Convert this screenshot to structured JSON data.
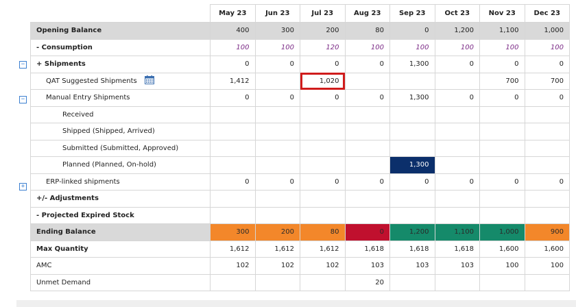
{
  "months": [
    "May 23",
    "Jun 23",
    "Jul 23",
    "Aug 23",
    "Sep 23",
    "Oct 23",
    "Nov 23",
    "Dec 23"
  ],
  "rows": [
    {
      "key": "opening",
      "label": "Opening Balance",
      "values": [
        "400",
        "300",
        "200",
        "80",
        "0",
        "1,200",
        "1,100",
        "1,000"
      ]
    },
    {
      "key": "consumption",
      "label": "- Consumption",
      "values": [
        "100",
        "100",
        "120",
        "100",
        "100",
        "100",
        "100",
        "100"
      ]
    },
    {
      "key": "shipments",
      "label": "+ Shipments",
      "values": [
        "0",
        "0",
        "0",
        "0",
        "1,300",
        "0",
        "0",
        "0"
      ]
    },
    {
      "key": "qat",
      "label": "QAT Suggested Shipments",
      "values": [
        "1,412",
        "",
        "1,020",
        "",
        "",
        "",
        "700",
        "700"
      ]
    },
    {
      "key": "manual",
      "label": "Manual Entry Shipments",
      "values": [
        "0",
        "0",
        "0",
        "0",
        "1,300",
        "0",
        "0",
        "0"
      ]
    },
    {
      "key": "received",
      "label": "Received",
      "values": [
        "",
        "",
        "",
        "",
        "",
        "",
        "",
        ""
      ]
    },
    {
      "key": "shipped",
      "label": "Shipped (Shipped, Arrived)",
      "values": [
        "",
        "",
        "",
        "",
        "",
        "",
        "",
        ""
      ]
    },
    {
      "key": "submitted",
      "label": "Submitted (Submitted, Approved)",
      "values": [
        "",
        "",
        "",
        "",
        "",
        "",
        "",
        ""
      ]
    },
    {
      "key": "planned",
      "label": "Planned (Planned, On-hold)",
      "values": [
        "",
        "",
        "",
        "",
        "1,300",
        "",
        "",
        ""
      ]
    },
    {
      "key": "erp",
      "label": "ERP-linked shipments",
      "values": [
        "0",
        "0",
        "0",
        "0",
        "0",
        "0",
        "0",
        "0"
      ]
    },
    {
      "key": "adjustments",
      "label": "+/- Adjustments",
      "values": [
        "",
        "",
        "",
        "",
        "",
        "",
        "",
        ""
      ]
    },
    {
      "key": "expired",
      "label": "- Projected Expired Stock",
      "values": [
        "",
        "",
        "",
        "",
        "",
        "",
        "",
        ""
      ]
    },
    {
      "key": "ending",
      "label": "Ending Balance",
      "values": [
        "300",
        "200",
        "80",
        "0",
        "1,200",
        "1,100",
        "1,000",
        "900"
      ]
    },
    {
      "key": "maxqty",
      "label": "Max Quantity",
      "values": [
        "1,612",
        "1,612",
        "1,612",
        "1,618",
        "1,618",
        "1,618",
        "1,600",
        "1,600"
      ]
    },
    {
      "key": "amc",
      "label": "AMC",
      "values": [
        "102",
        "102",
        "102",
        "103",
        "103",
        "103",
        "100",
        "100"
      ]
    },
    {
      "key": "unmet",
      "label": "Unmet Demand",
      "values": [
        "",
        "",
        "",
        "20",
        "",
        "",
        "",
        ""
      ]
    }
  ],
  "ending_status": [
    "orange",
    "orange",
    "orange",
    "red",
    "green",
    "green",
    "green",
    "orange"
  ],
  "colors": {
    "orange": "#f3872a",
    "red": "#c0102e",
    "green": "#158a6a",
    "navy": "#0b2f6b",
    "highlight": "#d01c1c",
    "gray": "#d9d9d9"
  },
  "icons": {
    "calendar": "calendar-icon",
    "collapse": "minus-square-icon",
    "expand": "plus-square-icon"
  },
  "toggles": {
    "shipments": "⊟",
    "manual": "⊟",
    "erp": "⊞"
  }
}
